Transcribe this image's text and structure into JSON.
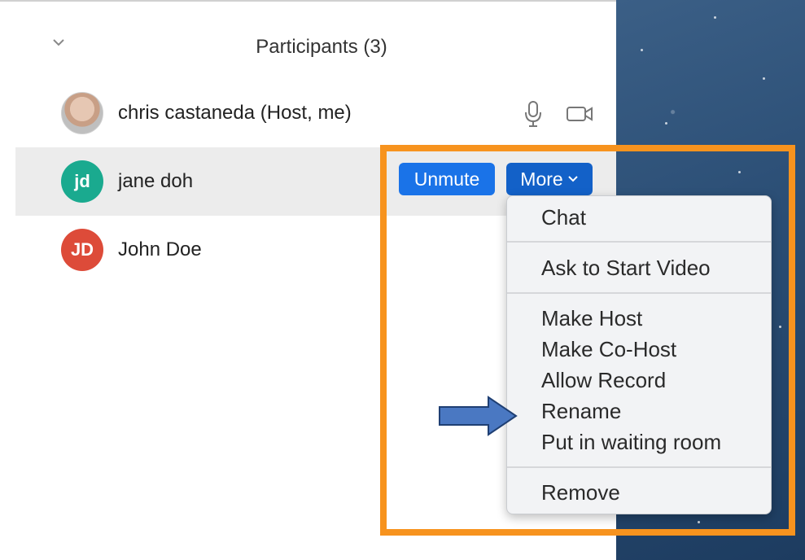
{
  "header": {
    "title": "Participants (3)",
    "collapse_icon": "chevron-down-icon"
  },
  "participants": [
    {
      "name": "chris castaneda (Host, me)",
      "avatar": "photo",
      "icons": [
        "microphone-icon",
        "video-camera-icon"
      ]
    },
    {
      "name": "jane doh",
      "initials": "jd",
      "avatar_color": "#1aaa8f"
    },
    {
      "name": "John Doe",
      "initials": "JD",
      "avatar_color": "#dd4b39"
    }
  ],
  "actions": {
    "unmute_label": "Unmute",
    "more_label": "More"
  },
  "menu": {
    "items": [
      "Chat",
      "Ask to Start Video",
      "Make Host",
      "Make Co-Host",
      "Allow Record",
      "Rename",
      "Put in waiting room",
      "Remove"
    ]
  },
  "annotation": {
    "highlight_color": "#f7931e",
    "arrow_color": "#4a78c2",
    "arrow_target": "Rename"
  },
  "colors": {
    "unmute_button": "#1a73e8",
    "more_button": "#1361c8"
  }
}
